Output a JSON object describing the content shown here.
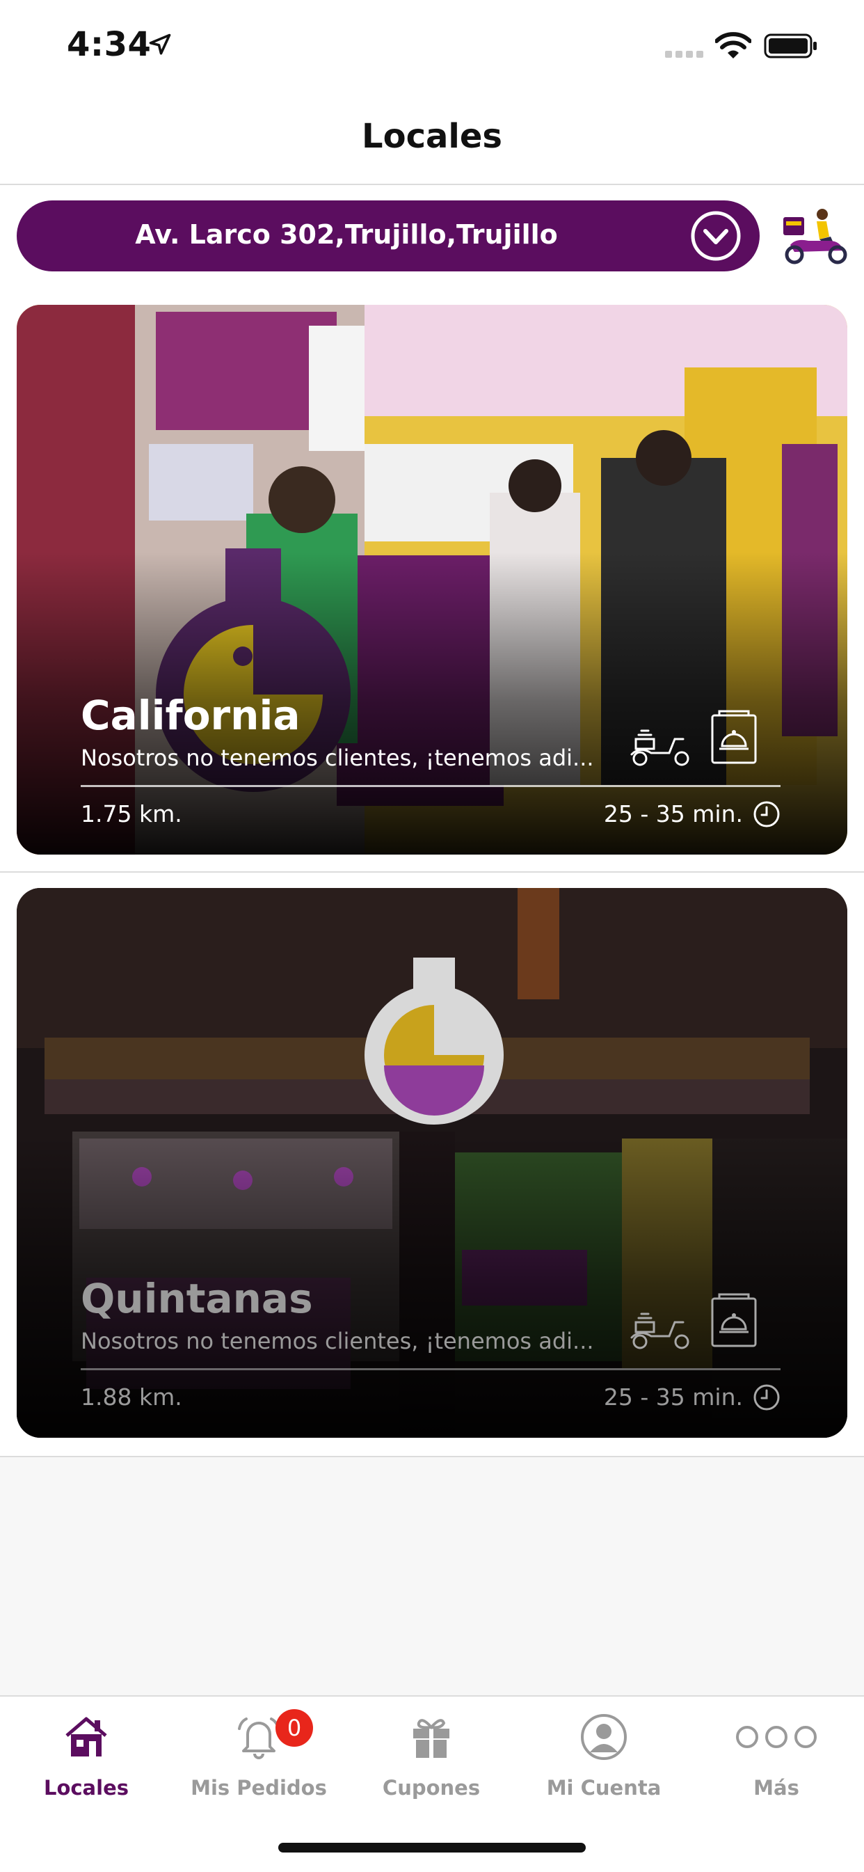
{
  "status_bar": {
    "time": "4:34"
  },
  "header": {
    "title": "Locales"
  },
  "address_bar": {
    "address": "Av. Larco 302,Trujillo,Trujillo"
  },
  "stores": [
    {
      "name": "California",
      "description": "Nosotros no tenemos clientes, ¡tenemos adi...",
      "distance": "1.75 km.",
      "delivery_time": "25 - 35 min."
    },
    {
      "name": "Quintanas",
      "description": "Nosotros no tenemos clientes, ¡tenemos adi...",
      "distance": "1.88 km.",
      "delivery_time": "25 - 35 min."
    }
  ],
  "tabs": [
    {
      "label": "Locales",
      "icon": "home-icon",
      "active": true
    },
    {
      "label": "Mis Pedidos",
      "icon": "bell-icon",
      "badge": "0"
    },
    {
      "label": "Cupones",
      "icon": "gift-icon"
    },
    {
      "label": "Mi Cuenta",
      "icon": "user-icon"
    },
    {
      "label": "Más",
      "icon": "more-icon"
    }
  ],
  "colors": {
    "brand_purple": "#5b0d5f",
    "badge_red": "#e8261b",
    "inactive_gray": "#9a9a9a"
  }
}
